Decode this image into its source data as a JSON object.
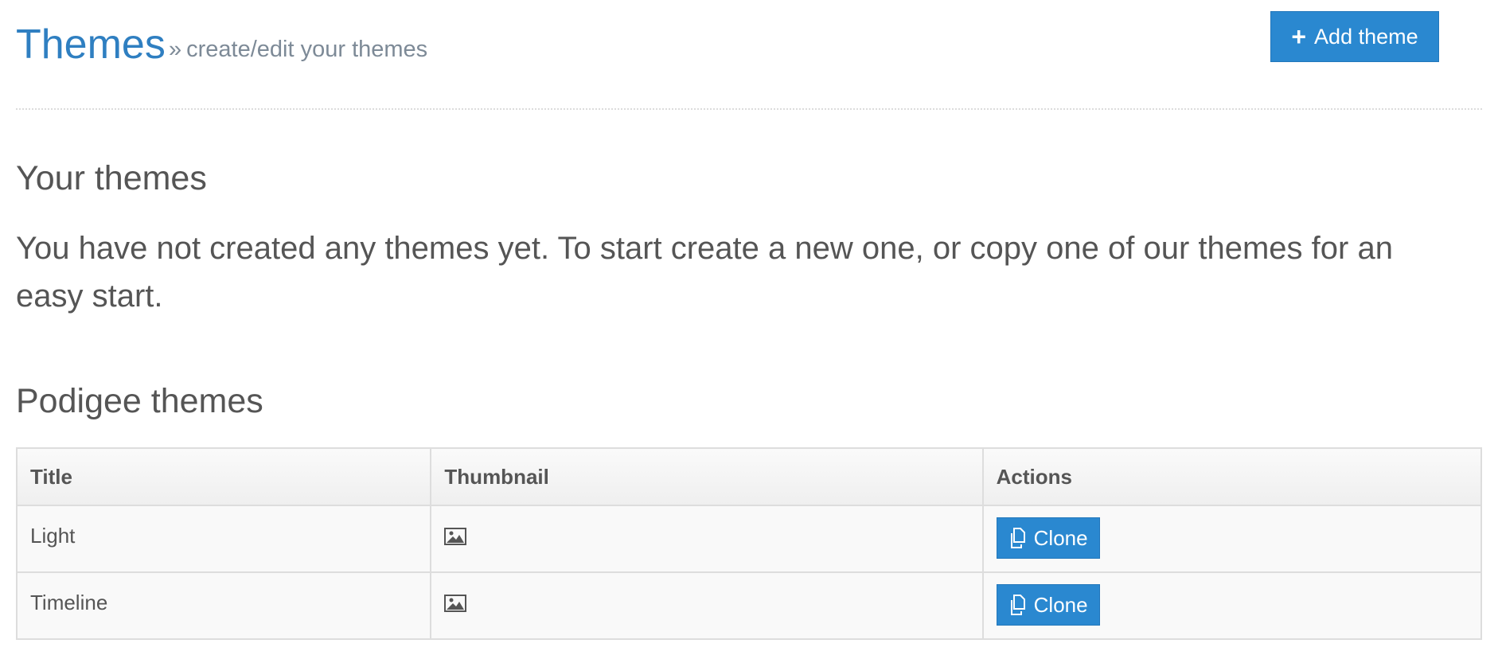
{
  "header": {
    "title": "Themes",
    "subtitle_prefix": "»",
    "subtitle": "create/edit your themes",
    "add_button": {
      "icon": "plus-icon",
      "label": "Add theme"
    }
  },
  "your_themes": {
    "title": "Your themes",
    "empty_message": "You have not created any themes yet. To start create a new one, or copy one of our themes for an easy start."
  },
  "podigee_themes": {
    "title": "Podigee themes",
    "columns": [
      "Title",
      "Thumbnail",
      "Actions"
    ],
    "rows": [
      {
        "title": "Light",
        "thumbnail_icon": "image-icon",
        "action_label": "Clone",
        "action_icon": "copy-icon"
      },
      {
        "title": "Timeline",
        "thumbnail_icon": "image-icon",
        "action_label": "Clone",
        "action_icon": "copy-icon"
      }
    ]
  },
  "colors": {
    "primary": "#2a88d0",
    "title_blue": "#2f7fc1",
    "text": "#555555",
    "muted": "#7d8a97",
    "border": "#dddddd"
  }
}
